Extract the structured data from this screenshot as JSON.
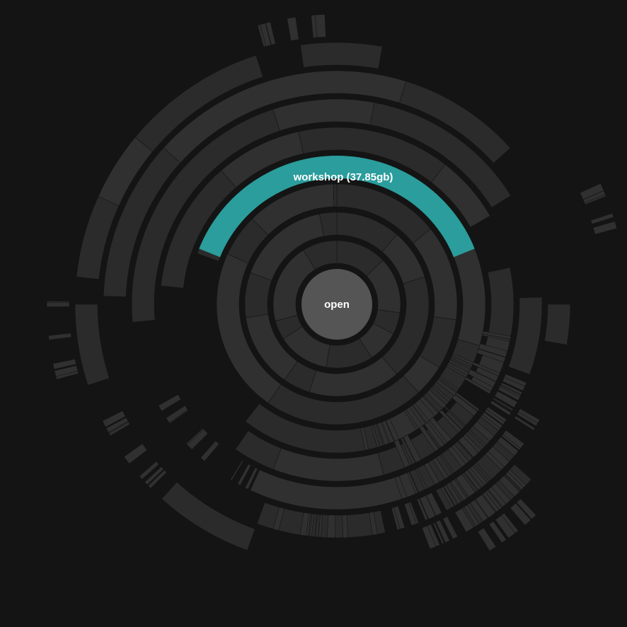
{
  "center": {
    "label": "open"
  },
  "highlight": {
    "label": "workshop (37.85gb)"
  },
  "colors": {
    "background": "#141414",
    "segment": "#2b2b2b",
    "segment_alt": "#303030",
    "highlight": "#2a9d9c",
    "center": "#555555"
  }
}
